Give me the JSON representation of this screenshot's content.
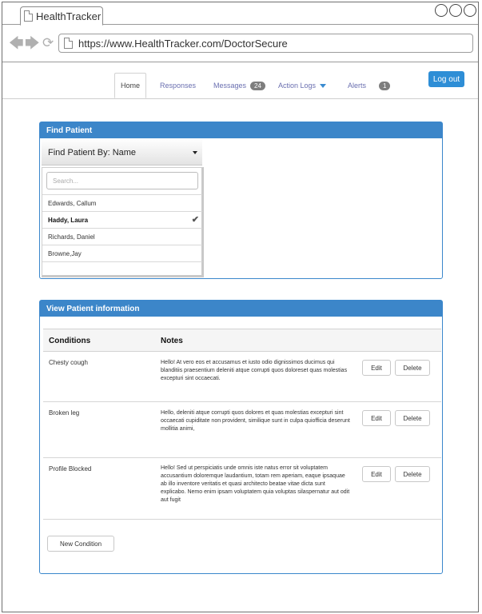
{
  "browser": {
    "tab_title": "HealthTracker",
    "url": "https://www.HealthTracker.com/DoctorSecure"
  },
  "nav": {
    "tabs": [
      {
        "label": "Home"
      },
      {
        "label": "Responses"
      },
      {
        "label": "Messages",
        "badge": "24"
      },
      {
        "label": "Action Logs"
      },
      {
        "label": "Alerts",
        "badge": "1"
      }
    ],
    "logout": "Log out"
  },
  "find_patient": {
    "title": "Find Patient",
    "dropdown_label": "Find Patient By: Name",
    "search_placeholder": "Search...",
    "patients": [
      "Edwards, Callum",
      "Haddy, Laura",
      "Richards, Daniel",
      "Browne,Jay"
    ],
    "selected": "Haddy, Laura"
  },
  "view_patient": {
    "title": "View Patient information",
    "col_conditions": "Conditions",
    "col_notes": "Notes",
    "rows": [
      {
        "condition": "Chesty cough",
        "notes": "Hello! At vero eos et accusamus et iusto odio dignissimos ducimus qui blanditiis praesentium deleniti atque corrupti quos doloreset quas molestias excepturi sint occaecati."
      },
      {
        "condition": "Broken leg",
        "notes": "Hello, deleniti atque corrupti quos dolores et quas molestias excepturi sint occaecati cupiditate non provident, similique sunt in culpa quiofficia deserunt mollitia animi,"
      },
      {
        "condition": "Profile Blocked",
        "notes": "Hello! Sed ut perspiciatis unde omnis iste natus error sit voluptatem accusantium doloremque laudantium, totam rem aperiam, eaque ipsaquae ab illo inventore veritatis et quasi architecto beatae vitae dicta sunt explicabo. Nemo enim ipsam voluptatem quia voluptas silaspernatur aut odit aut fugit"
      }
    ],
    "edit_label": "Edit",
    "delete_label": "Delete",
    "new_condition": "New Condition"
  }
}
